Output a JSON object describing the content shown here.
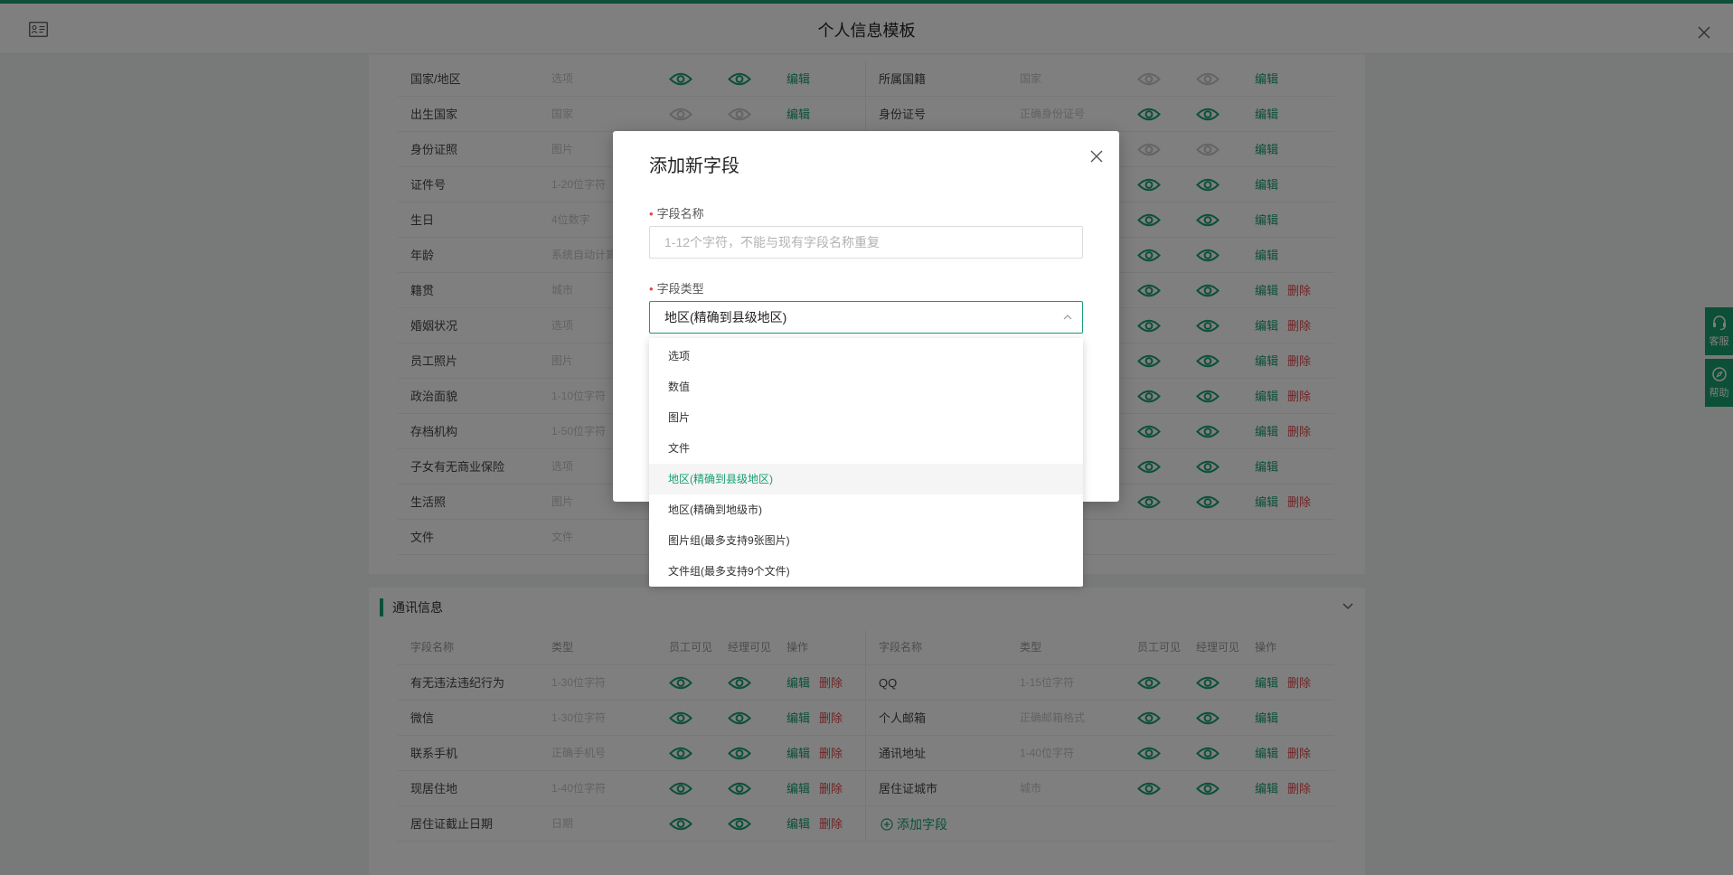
{
  "header": {
    "title": "个人信息模板"
  },
  "basic_rows": [
    {
      "l": {
        "name": "国家/地区",
        "type": "选项",
        "v1": "on",
        "v2": "on",
        "ops": [
          "edit"
        ]
      },
      "r": {
        "name": "所属国籍",
        "type": "国家",
        "v1": "off",
        "v2": "off",
        "ops": [
          "edit"
        ]
      }
    },
    {
      "l": {
        "name": "出生国家",
        "type": "国家",
        "v1": "off",
        "v2": "off",
        "ops": [
          "edit"
        ]
      },
      "r": {
        "name": "身份证号",
        "type": "正确身份证号",
        "v1": "on",
        "v2": "on",
        "ops": [
          "edit"
        ]
      }
    },
    {
      "l": {
        "name": "身份证照",
        "type": "图片",
        "v1": "",
        "v2": "",
        "ops": []
      },
      "r": {
        "name": "",
        "type": "",
        "v1": "off",
        "v2": "off",
        "ops": [
          "edit"
        ]
      }
    },
    {
      "l": {
        "name": "证件号",
        "type": "1-20位字符",
        "v1": "",
        "v2": "",
        "ops": []
      },
      "r": {
        "name": "",
        "type": "",
        "v1": "on",
        "v2": "on",
        "ops": [
          "edit"
        ]
      }
    },
    {
      "l": {
        "name": "生日",
        "type": "4位数字",
        "v1": "",
        "v2": "",
        "ops": []
      },
      "r": {
        "name": "",
        "type": "",
        "v1": "on",
        "v2": "on",
        "ops": [
          "edit"
        ]
      }
    },
    {
      "l": {
        "name": "年龄",
        "type": "系统自动计算",
        "v1": "",
        "v2": "",
        "ops": []
      },
      "r": {
        "name": "",
        "type": "",
        "v1": "on",
        "v2": "on",
        "ops": [
          "edit"
        ]
      }
    },
    {
      "l": {
        "name": "籍贯",
        "type": "城市",
        "v1": "",
        "v2": "",
        "ops": []
      },
      "r": {
        "name": "",
        "type": "",
        "v1": "on",
        "v2": "on",
        "ops": [
          "edit",
          "delete"
        ]
      }
    },
    {
      "l": {
        "name": "婚姻状况",
        "type": "选项",
        "v1": "",
        "v2": "",
        "ops": []
      },
      "r": {
        "name": "",
        "type": "",
        "v1": "on",
        "v2": "on",
        "ops": [
          "edit",
          "delete"
        ]
      }
    },
    {
      "l": {
        "name": "员工照片",
        "type": "图片",
        "v1": "",
        "v2": "",
        "ops": []
      },
      "r": {
        "name": "",
        "type": "",
        "v1": "on",
        "v2": "on",
        "ops": [
          "edit",
          "delete"
        ]
      }
    },
    {
      "l": {
        "name": "政治面貌",
        "type": "1-10位字符",
        "v1": "",
        "v2": "",
        "ops": []
      },
      "r": {
        "name": "",
        "type": "",
        "v1": "on",
        "v2": "on",
        "ops": [
          "edit",
          "delete"
        ]
      }
    },
    {
      "l": {
        "name": "存档机构",
        "type": "1-50位字符",
        "v1": "",
        "v2": "",
        "ops": []
      },
      "r": {
        "name": "",
        "type": "",
        "v1": "on",
        "v2": "on",
        "ops": [
          "edit",
          "delete"
        ]
      }
    },
    {
      "l": {
        "name": "子女有无商业保险",
        "type": "选项",
        "v1": "",
        "v2": "",
        "ops": []
      },
      "r": {
        "name": "",
        "type": "",
        "v1": "on",
        "v2": "on",
        "ops": [
          "edit"
        ]
      }
    },
    {
      "l": {
        "name": "生活照",
        "type": "图片",
        "v1": "",
        "v2": "",
        "ops": []
      },
      "r": {
        "name": "",
        "type": "",
        "v1": "on",
        "v2": "on",
        "ops": [
          "edit",
          "delete"
        ]
      }
    },
    {
      "l": {
        "name": "文件",
        "type": "文件",
        "v1": "",
        "v2": "",
        "ops": []
      },
      "r": null
    }
  ],
  "contact": {
    "title": "通讯信息",
    "headers": {
      "name": "字段名称",
      "type": "类型",
      "v1": "员工可见",
      "v2": "经理可见",
      "ops": "操作"
    },
    "rows": [
      {
        "l": {
          "name": "有无违法违纪行为",
          "type": "1-30位字符",
          "v1": "on",
          "v2": "on",
          "ops": [
            "edit",
            "delete"
          ]
        },
        "r": {
          "name": "QQ",
          "type": "1-15位字符",
          "v1": "on",
          "v2": "on",
          "ops": [
            "edit",
            "delete"
          ]
        }
      },
      {
        "l": {
          "name": "微信",
          "type": "1-30位字符",
          "v1": "on",
          "v2": "on",
          "ops": [
            "edit",
            "delete"
          ]
        },
        "r": {
          "name": "个人邮箱",
          "type": "正确邮箱格式",
          "v1": "on",
          "v2": "on",
          "ops": [
            "edit"
          ]
        }
      },
      {
        "l": {
          "name": "联系手机",
          "type": "正确手机号",
          "v1": "on",
          "v2": "on",
          "ops": [
            "edit",
            "delete"
          ]
        },
        "r": {
          "name": "通讯地址",
          "type": "1-40位字符",
          "v1": "on",
          "v2": "on",
          "ops": [
            "edit",
            "delete"
          ]
        }
      },
      {
        "l": {
          "name": "现居住地",
          "type": "1-40位字符",
          "v1": "on",
          "v2": "on",
          "ops": [
            "edit",
            "delete"
          ]
        },
        "r": {
          "name": "居住证城市",
          "type": "城市",
          "v1": "on",
          "v2": "on",
          "ops": [
            "edit",
            "delete"
          ]
        }
      },
      {
        "l": {
          "name": "居住证截止日期",
          "type": "日期",
          "v1": "on",
          "v2": "on",
          "ops": [
            "edit",
            "delete"
          ]
        },
        "r": "add"
      }
    ],
    "add_field_label": "添加字段"
  },
  "ops_labels": {
    "edit": "编辑",
    "delete": "删除"
  },
  "side_tabs": {
    "service": "客服",
    "help": "帮助"
  },
  "modal": {
    "title": "添加新字段",
    "name_label": "字段名称",
    "name_placeholder": "1-12个字符，不能与现有字段名称重复",
    "name_value": "",
    "type_label": "字段类型",
    "type_value": "地区(精确到县级地区)",
    "options": [
      {
        "label": "选项"
      },
      {
        "label": "数值"
      },
      {
        "label": "图片"
      },
      {
        "label": "文件"
      },
      {
        "label": "地区(精确到县级地区)",
        "selected": true
      },
      {
        "label": "地区(精确到地级市)"
      },
      {
        "label": "图片组(最多支持9张图片)"
      },
      {
        "label": "文件组(最多支持9个文件)"
      }
    ]
  },
  "colors": {
    "accent": "#17a06f",
    "danger": "#e0474a",
    "eye_off": "#c8c8c8"
  }
}
